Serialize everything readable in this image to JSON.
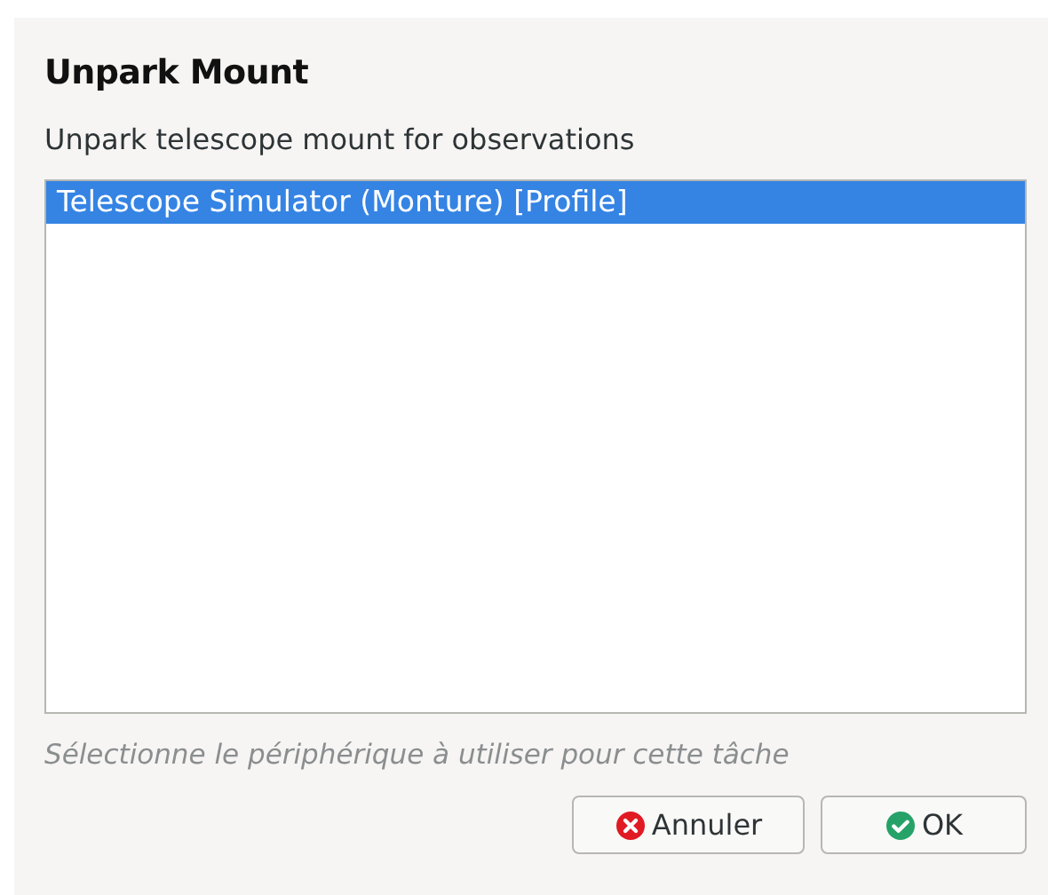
{
  "dialog": {
    "title": "Unpark Mount",
    "description": "Unpark telescope mount for observations"
  },
  "devices": [
    {
      "label": "Telescope Simulator (Monture) [Profile]",
      "selected": true
    }
  ],
  "hint": "Sélectionne le périphérique à utiliser pour cette tâche",
  "buttons": [
    {
      "kind": "cancel",
      "label": "Annuler"
    },
    {
      "kind": "ok",
      "label": "OK"
    }
  ]
}
